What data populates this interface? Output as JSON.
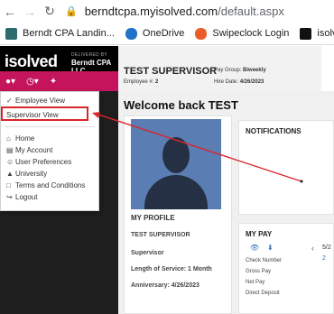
{
  "browser": {
    "url_domain": "berndtcpa.myisolved.com",
    "url_path": "/default.aspx",
    "bookmarks": [
      {
        "label": "Berndt CPA Landin...",
        "color": "#2c6b6f"
      },
      {
        "label": "OneDrive",
        "color": "#1e73c9"
      },
      {
        "label": "Swipeclock Login",
        "color": "#e85d2a"
      },
      {
        "label": "isolved People C",
        "color": "#111111"
      }
    ]
  },
  "app": {
    "logo": "isolved",
    "delivered_by": "DELIVERED BY",
    "company": "Berndt CPA LLC",
    "accent_color": "#c4155c"
  },
  "employee": {
    "name": "TEST SUPERVISOR",
    "employee_number_label": "Employee #:",
    "employee_number": "2",
    "pay_group_label": "Pay Group:",
    "pay_group": "Biweekly",
    "hire_date_label": "Hire Date:",
    "hire_date": "4/26/2023"
  },
  "menu": {
    "items": [
      {
        "label": "Employee View",
        "icon": "check-icon",
        "selected": true
      },
      {
        "label": "Supervisor View",
        "icon": "",
        "selected": false
      },
      {
        "label": "Home",
        "icon": "home-icon"
      },
      {
        "label": "My Account",
        "icon": "account-icon"
      },
      {
        "label": "User Preferences",
        "icon": "person-icon"
      },
      {
        "label": "University",
        "icon": "graduation-icon"
      },
      {
        "label": "Terms and Conditions",
        "icon": "document-icon"
      },
      {
        "label": "Logout",
        "icon": "logout-icon"
      }
    ]
  },
  "main": {
    "welcome": "Welcome back TEST",
    "profile": {
      "title": "MY PROFILE",
      "name": "TEST SUPERVISOR",
      "role": "Supervisor",
      "length_of_service": "Length of Service: 1 Month",
      "anniversary": "Anniversary: 4/26/2023"
    },
    "notifications_title": "NOTIFICATIONS",
    "mypay": {
      "title": "MY PAY",
      "date_partial": "5/2",
      "value_partial": "2",
      "rows": [
        "Check Number",
        "Gross Pay",
        "Net Pay",
        "Direct Deposit"
      ]
    }
  }
}
